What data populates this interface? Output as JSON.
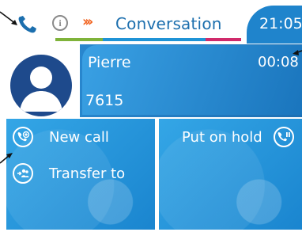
{
  "header": {
    "title": "Conversation",
    "time": "21:05",
    "icons": [
      "handset-icon",
      "info-icon",
      "chevrons-icon"
    ]
  },
  "call": {
    "name": "Pierre",
    "number": "7615",
    "duration": "00:08"
  },
  "actions": {
    "new_call": "New call",
    "transfer": "Transfer to",
    "hold": "Put on hold"
  },
  "colors": {
    "primary_blue": "#1f84cc",
    "tile_blue": "#2a97dc",
    "accent_green": "#7fb33a",
    "accent_magenta": "#d02a6b",
    "accent_orange": "#f26522"
  }
}
